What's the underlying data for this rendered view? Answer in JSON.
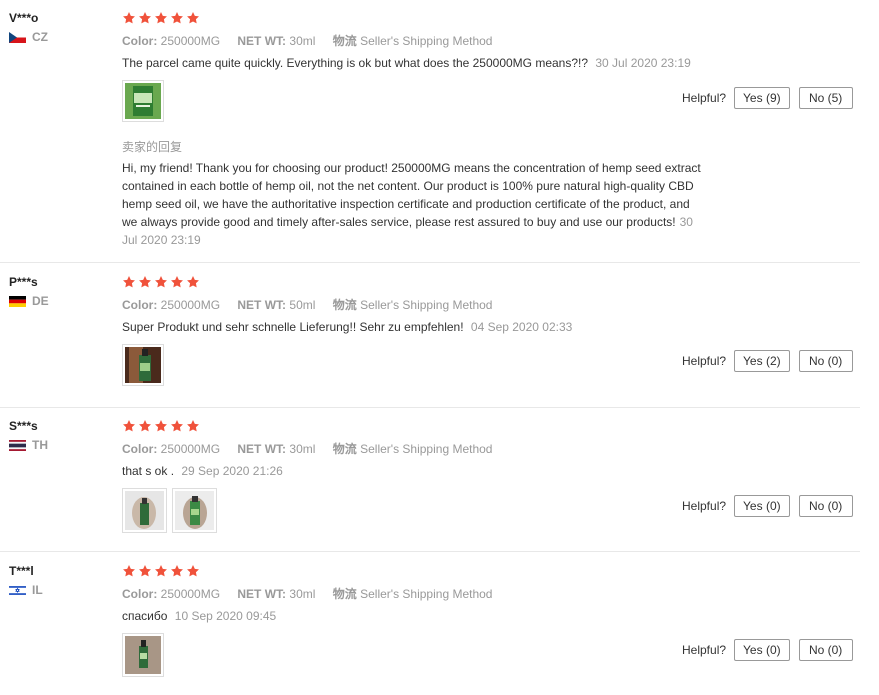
{
  "labels": {
    "color": "Color:",
    "netwt": "NET WT:",
    "logistics": "物流",
    "helpful": "Helpful?"
  },
  "reviews": [
    {
      "user": "V***o",
      "country": "CZ",
      "stars": 5,
      "color": "250000MG",
      "netwt": "30ml",
      "shipping": "Seller's Shipping Method",
      "text": "The parcel came quite quickly. Everything is ok but what does the 250000MG means?!?",
      "date": "30 Jul 2020 23:19",
      "yes": "Yes (9)",
      "no": "No (5)",
      "reply_title": "卖家的回复",
      "reply_lines": [
        "Hi, my friend! Thank you for choosing our product! 250000MG means the concentration of hemp seed extract",
        "contained in each bottle of hemp oil, not the net content. Our product is 100% pure natural high-quality CBD",
        "hemp seed oil, we have the authoritative inspection certificate and production certificate of the product, and",
        "we always provide good and timely after-sales service, please rest assured to buy and use our products!"
      ],
      "reply_date_a": "30",
      "reply_date_b": "Jul 2020 23:19"
    },
    {
      "user": "P***s",
      "country": "DE",
      "stars": 5,
      "color": "250000MG",
      "netwt": "50ml",
      "shipping": "Seller's Shipping Method",
      "text": "Super Produkt und sehr schnelle Lieferung!! Sehr zu empfehlen!",
      "date": "04 Sep 2020 02:33",
      "yes": "Yes (2)",
      "no": "No (0)"
    },
    {
      "user": "S***s",
      "country": "TH",
      "stars": 5,
      "color": "250000MG",
      "netwt": "30ml",
      "shipping": "Seller's Shipping Method",
      "text": "that s ok .",
      "date": "29 Sep 2020 21:26",
      "yes": "Yes (0)",
      "no": "No (0)"
    },
    {
      "user": "T***l",
      "country": "IL",
      "stars": 5,
      "color": "250000MG",
      "netwt": "30ml",
      "shipping": "Seller's Shipping Method",
      "text": "спасибо",
      "date": "10 Sep 2020 09:45",
      "yes": "Yes (0)",
      "no": "No (0)"
    }
  ],
  "colors": {
    "star": "#e62e04",
    "muted": "#999999",
    "text": "#333333",
    "divider": "#e8e8e8"
  }
}
